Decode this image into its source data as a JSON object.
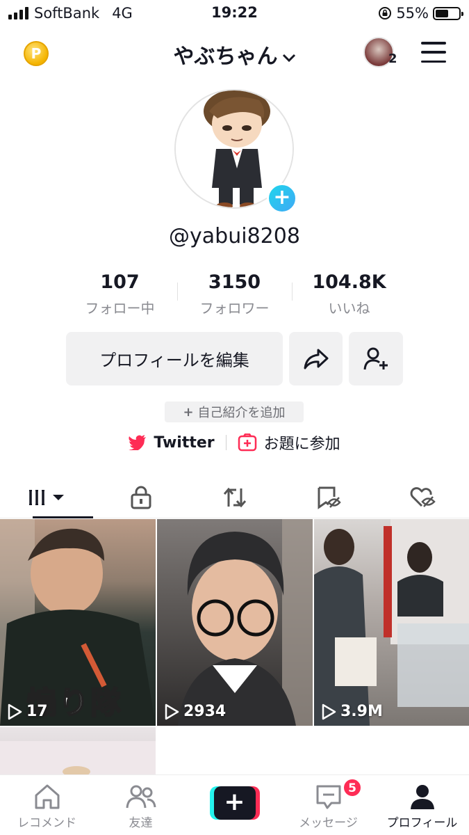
{
  "status_bar": {
    "carrier": "SoftBank",
    "network": "4G",
    "time": "19:22",
    "battery": "55%",
    "battery_level": 0.55
  },
  "header": {
    "coin_label": "P",
    "username": "やぶちゃん",
    "account_count": "2"
  },
  "profile": {
    "handle": "@yabui8208",
    "stats": [
      {
        "value": "107",
        "label": "フォロー中"
      },
      {
        "value": "3150",
        "label": "フォロワー"
      },
      {
        "value": "104.8K",
        "label": "いいね"
      }
    ],
    "edit_button": "プロフィールを編集",
    "bio_add": "自己紹介を追加",
    "bio_add_plus": "+",
    "links": {
      "twitter": "Twitter",
      "challenge": "お題に参加"
    }
  },
  "tabs": [
    "videos",
    "private",
    "reposts",
    "favorites",
    "liked"
  ],
  "videos": [
    {
      "views": "17",
      "overlay": "煽り隊"
    },
    {
      "views": "2934"
    },
    {
      "views": "3.9M"
    },
    {
      "views": ""
    }
  ],
  "bottom_nav": {
    "items": [
      "レコメンド",
      "友達",
      "",
      "メッセージ",
      "プロフィール"
    ],
    "message_badge": "5"
  },
  "colors": {
    "accent": "#fe2c55",
    "cyan": "#25f4ee",
    "text": "#161823",
    "muted": "#8a8b91"
  }
}
